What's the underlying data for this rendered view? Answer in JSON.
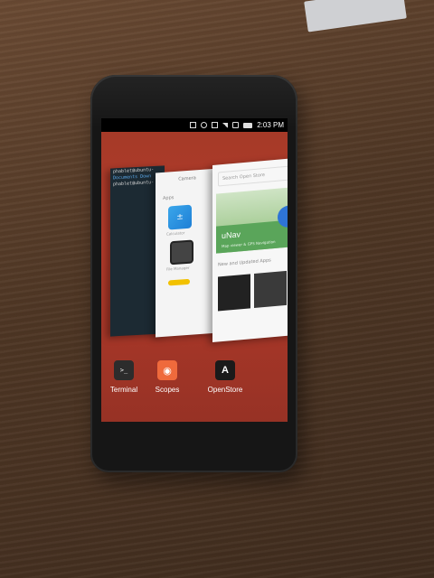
{
  "status_bar": {
    "time": "2:03 PM",
    "icons": [
      "message-icon",
      "alarm-icon",
      "battery-saver-icon",
      "signal-icon",
      "volume-icon",
      "battery-icon"
    ]
  },
  "app_spread": {
    "terminal_card": {
      "lines": [
        "phablet@ubuntu-",
        "Documents  Down",
        "phablet@ubuntu-"
      ]
    },
    "apps_card": {
      "header": "Camera",
      "section": "Apps",
      "tiles": [
        {
          "label": "Calculator",
          "icon": "calculator-icon"
        },
        {
          "label": "File Manager",
          "icon": "files-icon"
        }
      ]
    },
    "store_card": {
      "search_placeholder": "Search Open Store",
      "hero_title": "uNav",
      "hero_subtitle": "Map viewer & GPS Navigation",
      "section": "New and Updated Apps"
    }
  },
  "dock": {
    "apps": [
      {
        "label": "Terminal",
        "icon": "terminal-icon"
      },
      {
        "label": "Scopes",
        "icon": "scopes-icon"
      },
      {
        "label": "OpenStore",
        "icon": "openstore-icon"
      }
    ]
  }
}
